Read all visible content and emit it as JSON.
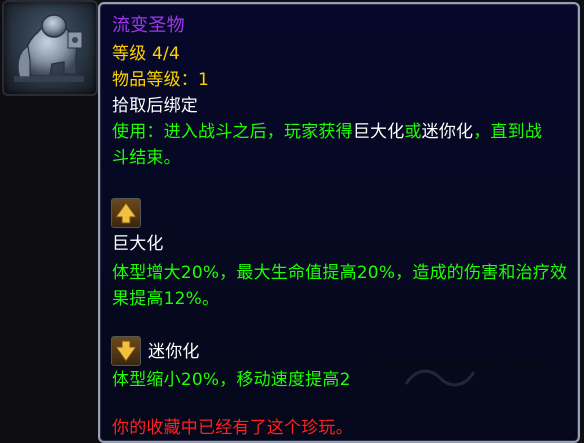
{
  "tooltip": {
    "item_name": "流变圣物",
    "level": "等级 4/4",
    "item_level": "物品等级：1",
    "bind": "拾取后绑定",
    "use_line1": "使用：进入战斗之后，玩家获得",
    "use_giant": "巨大化",
    "use_or": "或",
    "use_mini": "迷你化",
    "use_line1_end": "，直到战",
    "use_line2": "斗结束。",
    "giant_title": "巨大化",
    "giant_desc": "体型增大20%，最大生命值提高20%，造成的伤害和治疗效果提高12%。",
    "mini_title": "迷你化",
    "mini_desc": "体型缩小20%，移动速度提高2",
    "collection_note": "你的收藏中已经有了这个珍玩。"
  },
  "icons": {
    "item_icon": "gorilla-statue-icon",
    "giant_icon": "arrow-up-icon",
    "mini_icon": "arrow-down-icon"
  },
  "colors": {
    "epic": "#a335ee",
    "gold": "#ffd100",
    "green": "#1eff00",
    "red": "#ff2020",
    "white": "#ffffff"
  }
}
